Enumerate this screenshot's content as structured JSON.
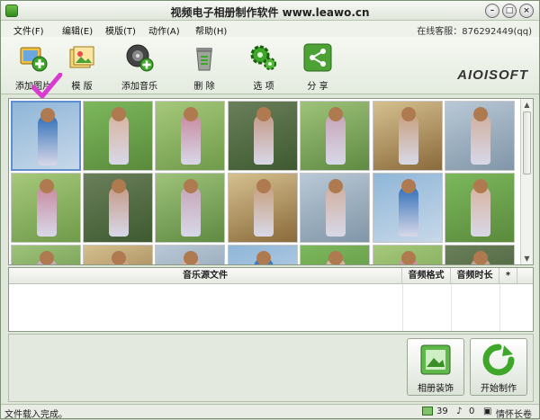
{
  "window": {
    "title": "视频电子相册制作软件 www.leawo.cn",
    "minimize": "–",
    "maximize": "□",
    "close": "×"
  },
  "menu": {
    "items": [
      "文件(F)",
      "编辑(E)",
      "模版(T)",
      "动作(A)",
      "帮助(H)"
    ],
    "service": "在线客服：876292449(qq)"
  },
  "toolbar": {
    "items": [
      {
        "label": "添加图片",
        "icon": "add-photo-icon"
      },
      {
        "label": "模 版",
        "icon": "template-icon"
      },
      {
        "label": "添加音乐",
        "icon": "add-music-icon"
      },
      {
        "label": "删 除",
        "icon": "trash-icon"
      },
      {
        "label": "选 项",
        "icon": "gear-icon"
      },
      {
        "label": "分 享",
        "icon": "share-icon"
      }
    ],
    "logo": "AIOISOFT"
  },
  "colors": {
    "accent_green": "#4ca234",
    "check_pink": "#d93bd0",
    "selection_blue": "#5f8fd0"
  },
  "music_table": {
    "columns": [
      "音乐源文件",
      "音频格式",
      "音频时长",
      "*"
    ]
  },
  "actions": {
    "decorate": "相册装饰",
    "start": "开始制作"
  },
  "status": {
    "text": "文件载入完成。",
    "photo_count": "39",
    "music_count": "0",
    "template_name": "情怀长卷"
  }
}
